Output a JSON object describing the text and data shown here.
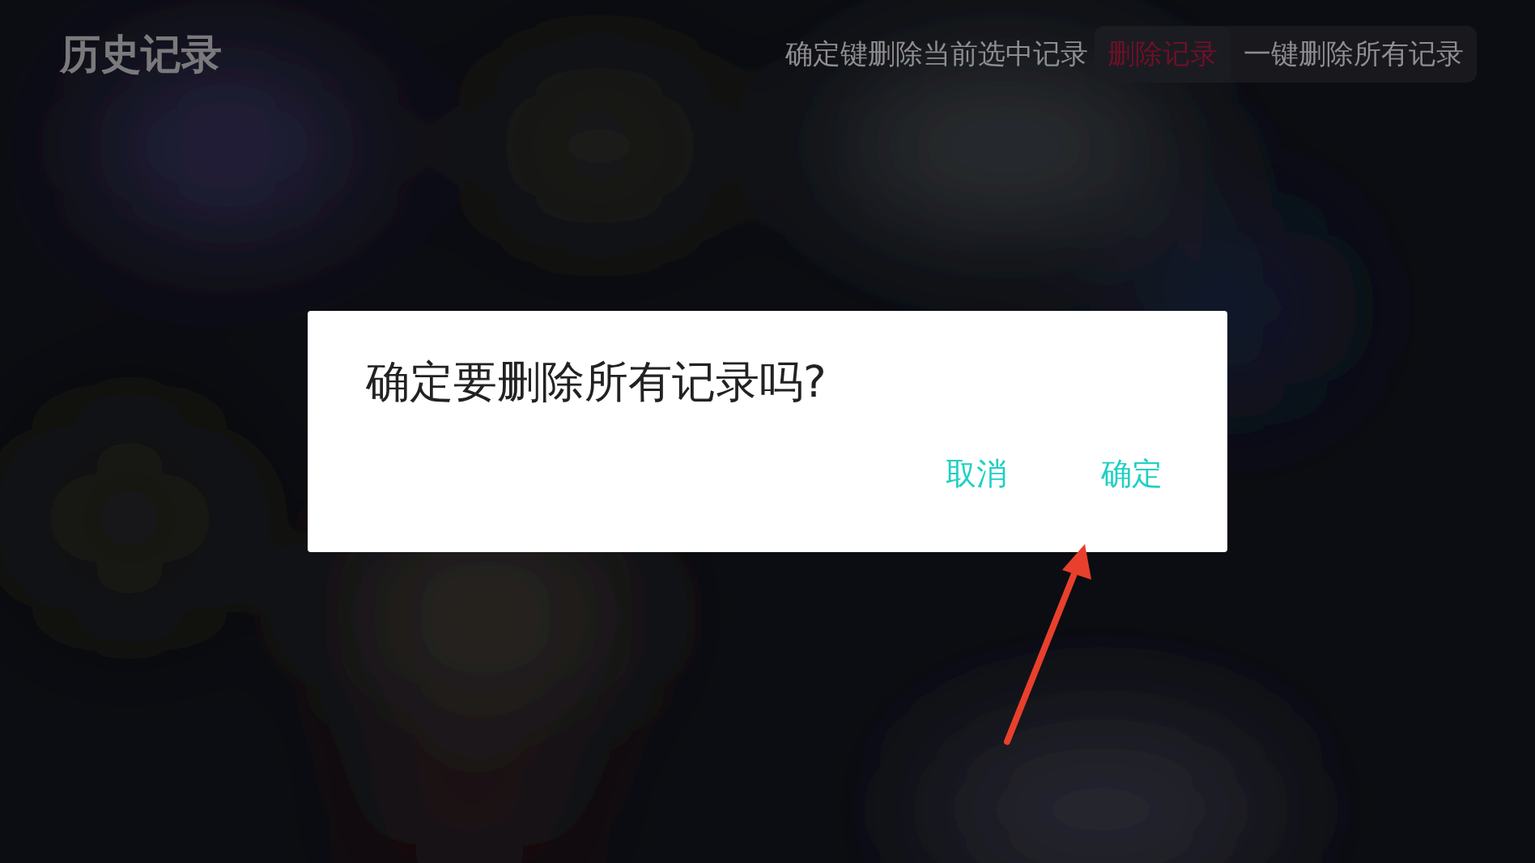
{
  "page": {
    "title": "历史记录"
  },
  "toolbar": {
    "hint": "确定键删除当前选中记录",
    "buttons": [
      {
        "label": "删除记录",
        "selected": true
      },
      {
        "label": "一键删除所有记录",
        "selected": false
      }
    ]
  },
  "dialog": {
    "message": "确定要删除所有记录吗?",
    "buttons": [
      {
        "label": "取消"
      },
      {
        "label": "确定"
      }
    ]
  }
}
